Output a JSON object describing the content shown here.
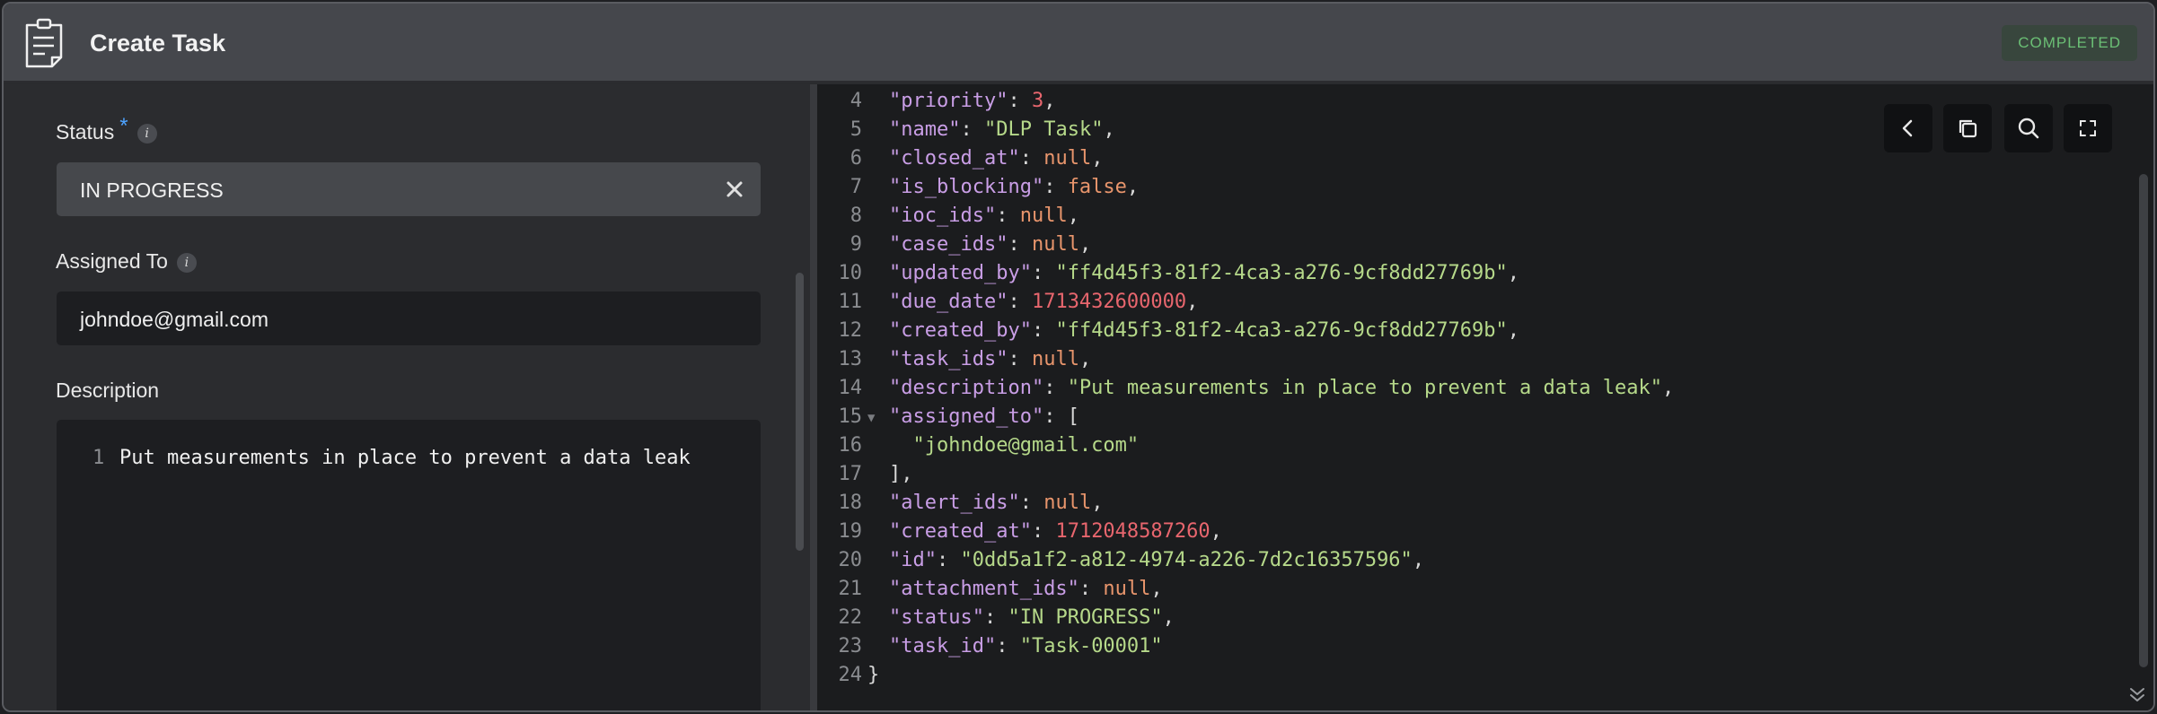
{
  "header": {
    "title": "Create Task",
    "badge": "COMPLETED",
    "icon": "task-clipboard-icon"
  },
  "form": {
    "status": {
      "label": "Status",
      "required_mark": "*",
      "info": "i",
      "value": "IN PROGRESS"
    },
    "assigned_to": {
      "label": "Assigned To",
      "info": "i",
      "value": "johndoe@gmail.com"
    },
    "description": {
      "label": "Description",
      "line_number": "1",
      "value": "Put measurements in place to prevent a data leak"
    }
  },
  "json_viewer": {
    "lines": [
      {
        "n": "4",
        "key": "\"priority\"",
        "val": "3",
        "vt": "n",
        "end": ","
      },
      {
        "n": "5",
        "key": "\"name\"",
        "val": "\"DLP Task\"",
        "vt": "s",
        "end": ","
      },
      {
        "n": "6",
        "key": "\"closed_at\"",
        "val": "null",
        "vt": "kw",
        "end": ","
      },
      {
        "n": "7",
        "key": "\"is_blocking\"",
        "val": "false",
        "vt": "kw",
        "end": ","
      },
      {
        "n": "8",
        "key": "\"ioc_ids\"",
        "val": "null",
        "vt": "kw",
        "end": ","
      },
      {
        "n": "9",
        "key": "\"case_ids\"",
        "val": "null",
        "vt": "kw",
        "end": ","
      },
      {
        "n": "10",
        "key": "\"updated_by\"",
        "val": "\"ff4d45f3-81f2-4ca3-a276-9cf8dd27769b\"",
        "vt": "s",
        "end": ","
      },
      {
        "n": "11",
        "key": "\"due_date\"",
        "val": "1713432600000",
        "vt": "n",
        "end": ","
      },
      {
        "n": "12",
        "key": "\"created_by\"",
        "val": "\"ff4d45f3-81f2-4ca3-a276-9cf8dd27769b\"",
        "vt": "s",
        "end": ","
      },
      {
        "n": "13",
        "key": "\"task_ids\"",
        "val": "null",
        "vt": "kw",
        "end": ","
      },
      {
        "n": "14",
        "key": "\"description\"",
        "val": "\"Put measurements in place to prevent a data leak\"",
        "vt": "s",
        "end": ","
      },
      {
        "n": "15",
        "key": "\"assigned_to\"",
        "val": "[",
        "vt": "p",
        "end": "",
        "fold": true
      },
      {
        "n": "16",
        "key": "",
        "val": "  \"johndoe@gmail.com\"",
        "vt": "s",
        "end": ""
      },
      {
        "n": "17",
        "key": "",
        "val": "],",
        "vt": "p",
        "end": ""
      },
      {
        "n": "18",
        "key": "\"alert_ids\"",
        "val": "null",
        "vt": "kw",
        "end": ","
      },
      {
        "n": "19",
        "key": "\"created_at\"",
        "val": "1712048587260",
        "vt": "n",
        "end": ","
      },
      {
        "n": "20",
        "key": "\"id\"",
        "val": "\"0dd5a1f2-a812-4974-a226-7d2c16357596\"",
        "vt": "s",
        "end": ","
      },
      {
        "n": "21",
        "key": "\"attachment_ids\"",
        "val": "null",
        "vt": "kw",
        "end": ","
      },
      {
        "n": "22",
        "key": "\"status\"",
        "val": "\"IN PROGRESS\"",
        "vt": "s",
        "end": ","
      },
      {
        "n": "23",
        "key": "\"task_id\"",
        "val": "\"Task-00001\"",
        "vt": "s",
        "end": ""
      },
      {
        "n": "24",
        "key": "",
        "val": "}",
        "vt": "p",
        "end": "",
        "outer": true
      }
    ],
    "tools": [
      "chevron-left-icon",
      "copy-icon",
      "search-icon",
      "fullscreen-icon"
    ]
  },
  "colors": {
    "key": "#c99ee6",
    "string": "#b6d98a",
    "number": "#e8666e",
    "keyword": "#e8956c",
    "badge_text": "#6bbf75"
  }
}
